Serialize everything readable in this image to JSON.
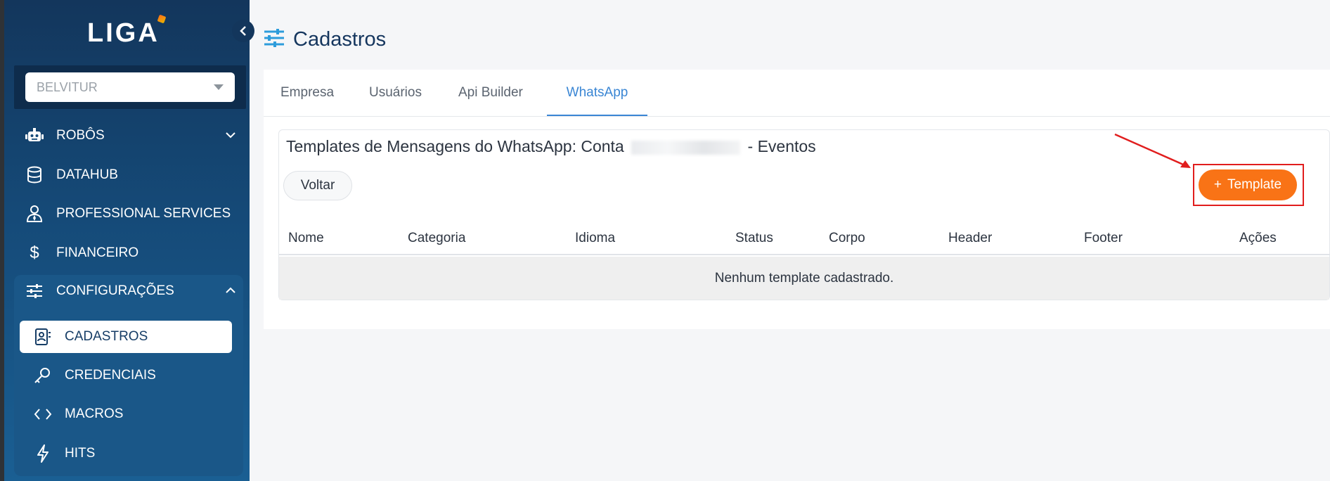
{
  "app": {
    "logo_text": "LIGA"
  },
  "sidebar": {
    "company_select": {
      "value": "BELVITUR"
    },
    "items": [
      {
        "label": "ROBÔS",
        "icon": "robot-icon"
      },
      {
        "label": "DATAHUB",
        "icon": "database-icon"
      },
      {
        "label": "PROFESSIONAL SERVICES",
        "icon": "user-tie-icon"
      },
      {
        "label": "FINANCEIRO",
        "icon": "dollar-icon"
      },
      {
        "label": "CONFIGURAÇÕES",
        "icon": "sliders-icon"
      }
    ],
    "config_sub_items": [
      {
        "label": "CADASTROS",
        "icon": "contact-book-icon",
        "active": true
      },
      {
        "label": "CREDENCIAIS",
        "icon": "key-icon"
      },
      {
        "label": "MACROS",
        "icon": "code-icon"
      },
      {
        "label": "HITS",
        "icon": "bolt-icon"
      }
    ]
  },
  "page": {
    "title": "Cadastros",
    "icon": "sliders-icon"
  },
  "tabs": [
    {
      "label": "Empresa"
    },
    {
      "label": "Usuários"
    },
    {
      "label": "Api Builder"
    },
    {
      "label": "WhatsApp",
      "active": true
    }
  ],
  "section": {
    "title_prefix": "Templates de Mensagens do WhatsApp: Conta",
    "title_suffix": "- Eventos",
    "back_label": "Voltar",
    "add_label": "Template",
    "add_icon": "+"
  },
  "table": {
    "columns": [
      "Nome",
      "Categoria",
      "Idioma",
      "Status",
      "Corpo",
      "Header",
      "Footer",
      "Ações"
    ],
    "empty_text": "Nenhum template cadastrado."
  },
  "colors": {
    "accent": "#3a86d4",
    "add_button": "#f97316",
    "highlight": "#e11d1d",
    "sidebar": "#154a78"
  }
}
